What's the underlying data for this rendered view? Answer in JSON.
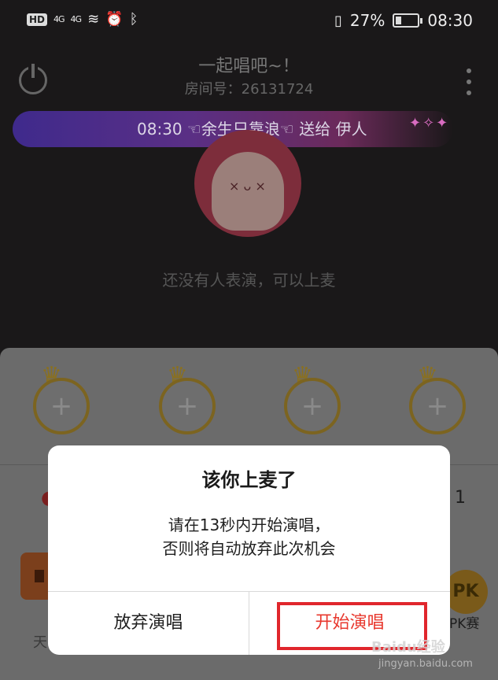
{
  "status_bar": {
    "hd": "HD",
    "signal_left": "4G",
    "signal_right": "4G",
    "battery_percent": "27%",
    "battery_level": 0.27,
    "time": "08:30",
    "icons": [
      "wifi-icon",
      "alarm-icon",
      "bluetooth-icon",
      "vibrate-icon",
      "battery-icon"
    ]
  },
  "header": {
    "room_title": "一起唱吧~！",
    "room_id": "房间号：26131724"
  },
  "gift_banner": {
    "text": "08:30 ☜余生只靠浪☜ 送给 伊人"
  },
  "stage": {
    "empty_text": "还没有人表演，可以上麦"
  },
  "mic_slots": [
    {
      "symbol": "+"
    },
    {
      "symbol": "+"
    },
    {
      "symbol": "+"
    },
    {
      "symbol": "+"
    }
  ],
  "panel": {
    "count": "1",
    "input_placeholder": "天",
    "pk_badge": "PK",
    "pk_label": "PK赛"
  },
  "dialog": {
    "title": "该你上麦了",
    "message_line1": "请在13秒内开始演唱，",
    "message_line2": "否则将自动放弃此次机会",
    "cancel_label": "放弃演唱",
    "confirm_label": "开始演唱",
    "confirm_color": "#e8382e"
  },
  "watermark": {
    "brand": "Baidu经验",
    "url": "jingyan.baidu.com"
  }
}
